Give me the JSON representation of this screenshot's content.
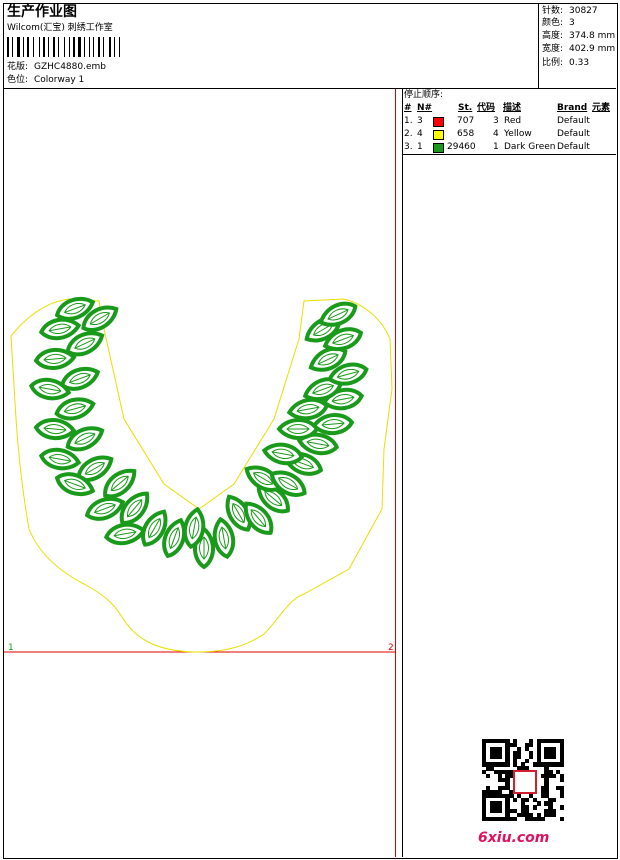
{
  "header": {
    "title": "生产作业图",
    "company": "Wilcom(汇宝) 刺绣工作室",
    "design_label": "花版:",
    "design_value": "GZHC4880.emb",
    "colorway_label": "色位:",
    "colorway_value": "Colorway 1"
  },
  "stats": [
    {
      "label": "针数:",
      "value": "30827"
    },
    {
      "label": "颜色:",
      "value": "3"
    },
    {
      "label": "高度:",
      "value": "374.8 mm"
    },
    {
      "label": "宽度:",
      "value": "402.9 mm"
    },
    {
      "label": "比例:",
      "value": "0.33"
    }
  ],
  "stop_sequence": {
    "title": "停止顺序:",
    "columns": {
      "num": "#",
      "needle": "N#",
      "stitches": "St.",
      "code": "代码",
      "desc": "描述",
      "brand": "Brand",
      "element": "元素"
    },
    "rows": [
      {
        "idx": "1.",
        "needle": "3",
        "stitches": "707",
        "code": "3",
        "desc": "Red",
        "brand": "Default",
        "color": "#ff0000"
      },
      {
        "idx": "2.",
        "needle": "4",
        "stitches": "658",
        "code": "4",
        "desc": "Yellow",
        "brand": "Default",
        "color": "#ffff00"
      },
      {
        "idx": "3.",
        "needle": "1",
        "stitches": "29460",
        "code": "1",
        "desc": "Dark Green",
        "brand": "Default",
        "color": "#1a9a1a"
      }
    ]
  },
  "canvas": {
    "marker_left": "1",
    "marker_right": "2",
    "marker_bottom": "1"
  },
  "watermark": "6xiu.com",
  "colors": {
    "red_line": "#e00000",
    "outline": "#e8e000",
    "leaf": "#1a9a1a"
  }
}
